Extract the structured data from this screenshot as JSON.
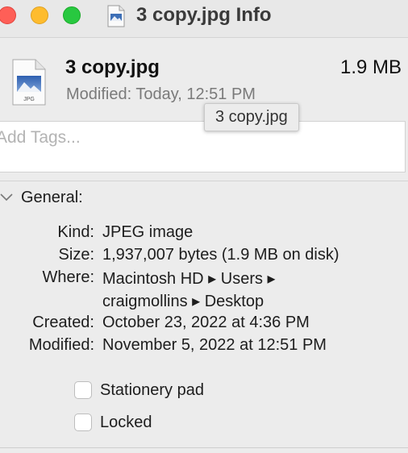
{
  "window": {
    "title": "3 copy.jpg Info"
  },
  "file": {
    "name": "3 copy.jpg",
    "size": "1.9 MB",
    "modified_label": "Modified:",
    "modified_value": "Today, 12:51 PM",
    "icon_badge": "JPG",
    "tooltip": "3 copy.jpg"
  },
  "tags": {
    "placeholder": "Add Tags..."
  },
  "general": {
    "header": "General:",
    "rows": [
      {
        "label": "Kind:",
        "value": "JPEG image"
      },
      {
        "label": "Size:",
        "value": "1,937,007 bytes (1.9 MB on disk)"
      },
      {
        "label": "Where:",
        "value": "Macintosh HD ▸ Users ▸",
        "value2": "craigmollins ▸ Desktop"
      },
      {
        "label": "Created:",
        "value": "October 23, 2022 at 4:36 PM"
      },
      {
        "label": "Modified:",
        "value": "November 5, 2022 at 12:51 PM"
      }
    ],
    "checkboxes": [
      {
        "label": "Stationery pad",
        "checked": false
      },
      {
        "label": "Locked",
        "checked": false
      }
    ]
  },
  "colors": {
    "close": "#fe5f57",
    "minimize": "#febc2e",
    "zoom": "#28c840"
  }
}
